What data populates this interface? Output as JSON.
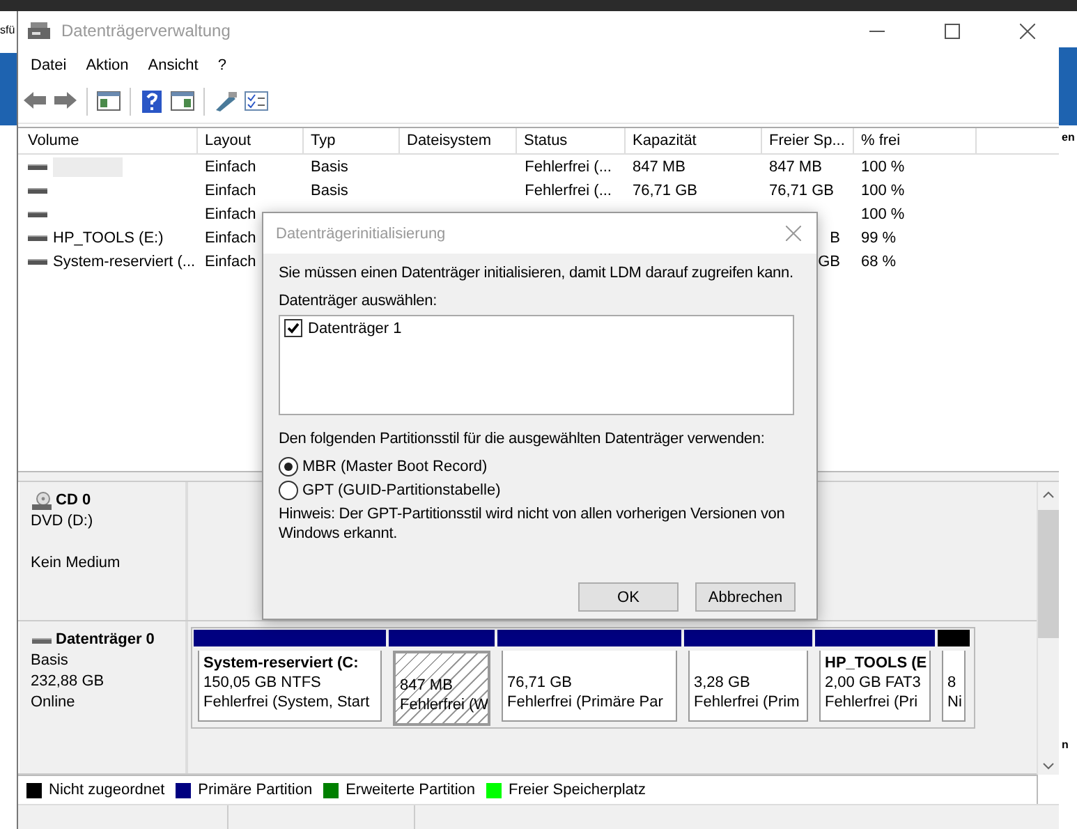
{
  "desktop": {
    "left_fragment": "sfü",
    "right_fragments": [
      "en",
      "n"
    ]
  },
  "window": {
    "title": "Datenträgerverwaltung"
  },
  "menu": [
    "Datei",
    "Aktion",
    "Ansicht",
    "?"
  ],
  "volume_table": {
    "columns": [
      "Volume",
      "Layout",
      "Typ",
      "Dateisystem",
      "Status",
      "Kapazität",
      "Freier Sp...",
      "% frei"
    ],
    "rows": [
      {
        "redacted": true,
        "cells": [
          null,
          "Einfach",
          "Basis",
          null,
          "Fehlerfrei (...",
          "847 MB",
          "847 MB",
          "100 %"
        ]
      },
      {
        "redacted": false,
        "cells": [
          null,
          "Einfach",
          "Basis",
          null,
          "Fehlerfrei (...",
          "76,71 GB",
          "76,71 GB",
          "100 %"
        ]
      },
      {
        "redacted": false,
        "cells": [
          null,
          "Einfach",
          null,
          null,
          null,
          null,
          null,
          "100 %"
        ]
      },
      {
        "redacted": false,
        "cells": [
          "HP_TOOLS (E:)",
          "Einfach",
          null,
          null,
          null,
          null,
          "B",
          "99 %"
        ]
      },
      {
        "redacted": false,
        "cells": [
          "System-reserviert (...",
          "Einfach",
          null,
          null,
          null,
          null,
          "GB",
          "68 %"
        ]
      }
    ]
  },
  "disks": [
    {
      "kind": "cd",
      "name": "CD 0",
      "type": "DVD (D:)",
      "status": "Kein Medium"
    },
    {
      "kind": "disk",
      "name": "Datenträger 0",
      "type": "Basis",
      "size": "232,88 GB",
      "status": "Online",
      "partitions": [
        {
          "kind": "primary",
          "title": "System-reserviert  (C:",
          "size": "150,05 GB NTFS",
          "status": "Fehlerfrei (System, Start",
          "selected": false
        },
        {
          "kind": "primary",
          "size": "847 MB",
          "status": "Fehlerfrei (W",
          "selected": true
        },
        {
          "kind": "primary",
          "size": "76,71 GB",
          "status": "Fehlerfrei (Primäre Par",
          "selected": false
        },
        {
          "kind": "primary",
          "size": "3,28 GB",
          "status": "Fehlerfrei (Prim",
          "selected": false
        },
        {
          "kind": "primary",
          "title": "HP_TOOLS  (E",
          "size": "2,00 GB FAT3",
          "status": "Fehlerfrei (Pri",
          "selected": false
        },
        {
          "kind": "unallocated",
          "size": "8",
          "status": "Ni",
          "selected": false
        }
      ]
    }
  ],
  "legend": [
    {
      "label": "Nicht zugeordnet",
      "color": "#000000"
    },
    {
      "label": "Primäre Partition",
      "color": "#000080"
    },
    {
      "label": "Erweiterte Partition",
      "color": "#008000"
    },
    {
      "label": "Freier Speicherplatz",
      "color": "#00ff00"
    }
  ],
  "dialog": {
    "title": "Datenträgerinitialisierung",
    "intro": "Sie müssen einen Datenträger initialisieren, damit LDM darauf zugreifen kann.",
    "select_label": "Datenträger auswählen:",
    "disks": [
      {
        "label": "Datenträger 1",
        "checked": true
      }
    ],
    "style_label": "Den folgenden Partitionsstil für die ausgewählten Datenträger verwenden:",
    "options": [
      {
        "label": "MBR (Master Boot Record)",
        "selected": true
      },
      {
        "label": "GPT (GUID-Partitionstabelle)",
        "selected": false
      }
    ],
    "note": "Hinweis: Der GPT-Partitionsstil wird nicht von allen vorherigen Versionen von Windows erkannt.",
    "buttons": [
      "OK",
      "Abbrechen"
    ]
  }
}
